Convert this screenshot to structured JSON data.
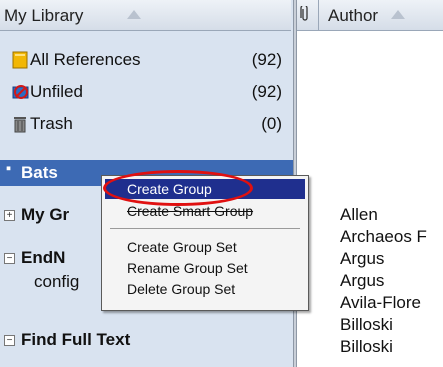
{
  "library": {
    "header": "My Library",
    "items": [
      {
        "label": "All References",
        "count": "(92)",
        "icon": "all-references-icon"
      },
      {
        "label": "Unfiled",
        "count": "(92)",
        "icon": "unfiled-icon"
      },
      {
        "label": "Trash",
        "count": "(0)",
        "icon": "trash-icon"
      }
    ],
    "groups": [
      {
        "label": "Bats",
        "toggle": "▪"
      },
      {
        "label": "My Gr",
        "toggle": "+"
      },
      {
        "label": "EndN",
        "toggle": "−"
      },
      {
        "label": "Find Full Text",
        "toggle": "−"
      }
    ],
    "subitem": "config"
  },
  "refs": {
    "clip_icon": "paperclip-icon",
    "author_header": "Author",
    "authors": [
      "Allen",
      "Archaeos F",
      "Argus",
      "Argus",
      "Avila-Flore",
      "Billoski",
      "Billoski"
    ]
  },
  "context_menu": {
    "items": [
      "Create Group",
      "Create Smart Group",
      "Create Group Set",
      "Rename Group Set",
      "Delete Group Set"
    ],
    "highlight_color": "#1f2f8e",
    "annotation_color": "#e01010"
  }
}
